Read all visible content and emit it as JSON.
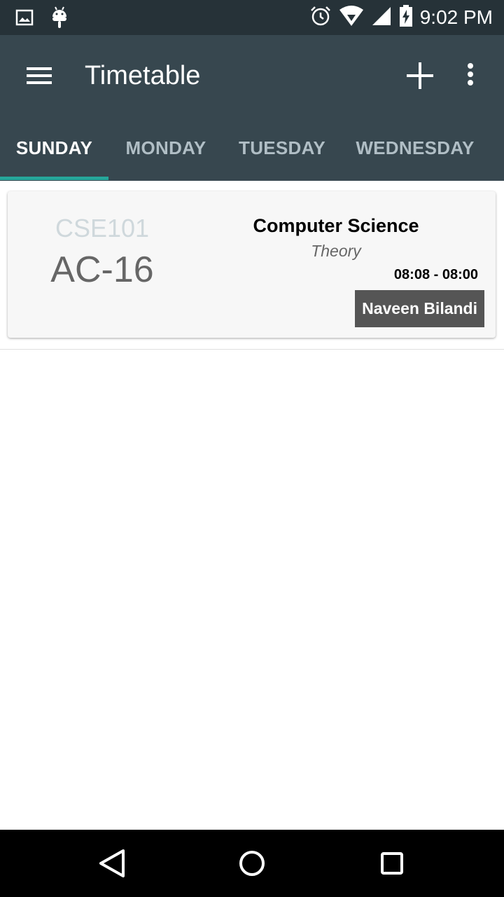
{
  "status_bar": {
    "time": "9:02 PM",
    "icons": [
      "image-icon",
      "android-icon",
      "alarm-icon",
      "wifi-icon",
      "signal-icon",
      "battery-charging-icon"
    ]
  },
  "app_bar": {
    "title": "Timetable",
    "icons": [
      "menu-icon",
      "add-icon",
      "more-vert-icon"
    ]
  },
  "tabs": [
    {
      "label": "SUNDAY",
      "active": true
    },
    {
      "label": "MONDAY",
      "active": false
    },
    {
      "label": "TUESDAY",
      "active": false
    },
    {
      "label": "WEDNESDAY",
      "active": false
    }
  ],
  "entries": [
    {
      "code": "CSE101",
      "room": "AC-16",
      "subject": "Computer Science",
      "type": "Theory",
      "time": "08:08 - 08:00",
      "teacher": "Naveen Bilandi"
    }
  ],
  "nav_bar": {
    "icons": [
      "back-icon",
      "home-icon",
      "recents-icon"
    ]
  },
  "colors": {
    "status_bar": "#263238",
    "app_bar": "#37474f",
    "tab_indicator": "#26a69a",
    "teacher_badge": "#555555"
  }
}
